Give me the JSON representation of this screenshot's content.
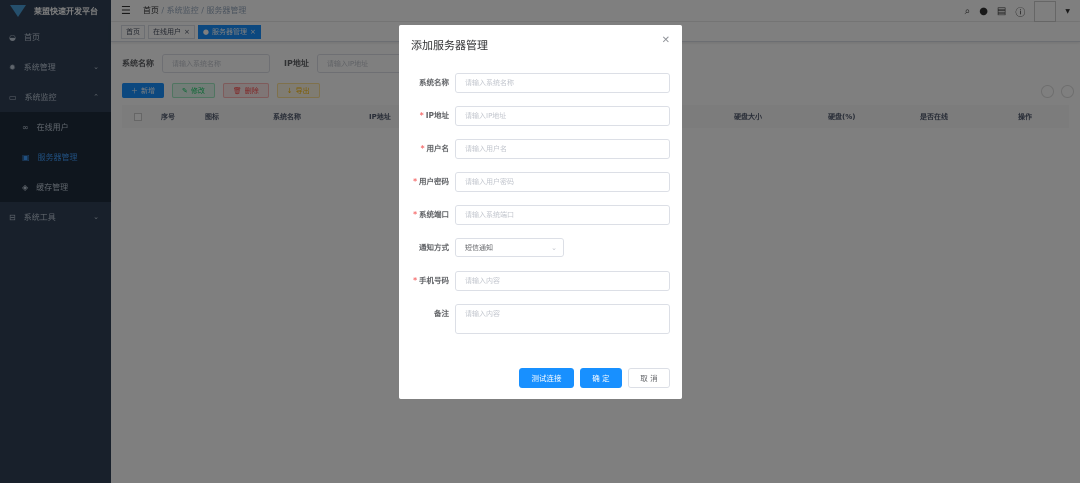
{
  "app": {
    "title": "莱盟快速开发平台"
  },
  "sidebar": {
    "items": [
      {
        "label": "首页",
        "icon": "dashboard-icon"
      },
      {
        "label": "系统管理",
        "icon": "gear-icon"
      },
      {
        "label": "系统监控",
        "icon": "monitor-icon"
      },
      {
        "label": "系统工具",
        "icon": "toolbox-icon"
      }
    ],
    "sub_items": [
      {
        "label": "在线用户",
        "icon": "online-icon"
      },
      {
        "label": "服务器管理",
        "icon": "server-icon",
        "active": true
      },
      {
        "label": "缓存管理",
        "icon": "redis-icon"
      }
    ]
  },
  "breadcrumb": [
    "首页",
    "系统监控",
    "服务器管理"
  ],
  "tags": [
    {
      "label": "首页"
    },
    {
      "label": "在线用户"
    },
    {
      "label": "服务器管理",
      "active": true
    }
  ],
  "search": {
    "name_label": "系统名称",
    "name_placeholder": "请输入系统名称",
    "ip_label": "IP地址",
    "ip_placeholder": "请输入IP地址"
  },
  "toolbar": {
    "add": "新增",
    "edit": "修改",
    "delete": "删除",
    "export": "导出"
  },
  "table": {
    "columns": [
      "序号",
      "图标",
      "系统名称",
      "IP地址",
      "硬盘大小",
      "硬盘(%)",
      "是否在线",
      "操作"
    ]
  },
  "dialog": {
    "title": "添加服务器管理",
    "fields": [
      {
        "label": "系统名称",
        "placeholder": "请输入系统名称",
        "required": false
      },
      {
        "label": "IP地址",
        "placeholder": "请输入IP地址",
        "required": true
      },
      {
        "label": "用户名",
        "placeholder": "请输入用户名",
        "required": true
      },
      {
        "label": "用户密码",
        "placeholder": "请输入用户密码",
        "required": true
      },
      {
        "label": "系统端口",
        "placeholder": "请输入系统端口",
        "required": true
      },
      {
        "label": "通知方式",
        "value": "短信通知",
        "required": false
      },
      {
        "label": "手机号码",
        "placeholder": "请输入内容",
        "required": true
      },
      {
        "label": "备注",
        "placeholder": "请输入内容",
        "required": false
      }
    ],
    "test_button": "测试连接",
    "confirm_button": "确 定",
    "cancel_button": "取 消"
  },
  "colors": {
    "primary": "#1890ff",
    "sidebar": "#304156",
    "success": "#13ce66",
    "danger": "#ff4949",
    "warning": "#ffba00"
  }
}
